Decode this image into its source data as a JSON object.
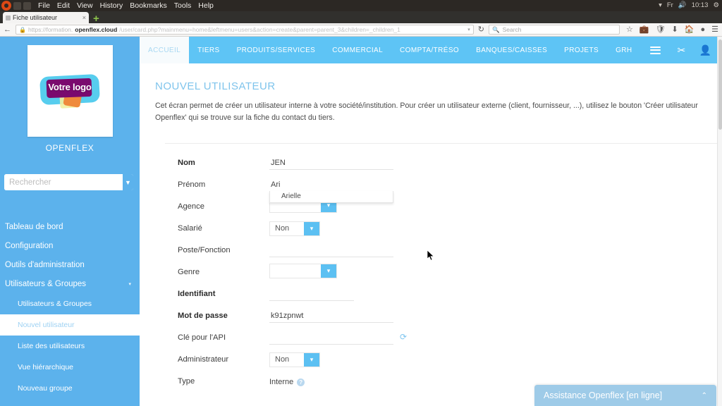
{
  "os": {
    "menus": [
      "File",
      "Edit",
      "View",
      "History",
      "Bookmarks",
      "Tools",
      "Help"
    ],
    "tray": {
      "wifi_icon": "wifi-icon",
      "keyboard_layout": "Fr",
      "volume_icon": "volume-icon",
      "clock": "10:13",
      "settings_icon": "gear-icon"
    }
  },
  "browser": {
    "tab_title": "Fiche utilisateur",
    "tab_close_label": "×",
    "new_tab_label": "+",
    "back_icon": "back-arrow-icon",
    "forward_icon": "forward-arrow-icon",
    "reload_icon": "reload-icon",
    "url": {
      "scheme": "https://formation.",
      "domain": "openflex.cloud",
      "path": "/user/card.php?mainmenu=home&leftmenu=users&action=create&parent=parent_3&children=_children_1",
      "lock_icon": "lock-icon",
      "dropdown_icon": "chevron-down-icon"
    },
    "search_placeholder": "Search",
    "search_icon": "search-icon",
    "toolbar_icons": [
      "star-icon",
      "pocket-icon",
      "shield-icon",
      "download-icon",
      "home-icon",
      "account-icon",
      "hamburger-menu-icon"
    ]
  },
  "sidebar": {
    "logo_text": "Votre logo",
    "app_name": "OPENFLEX",
    "search_placeholder": "Rechercher",
    "search_caret_icon": "chevron-down-icon",
    "items": [
      {
        "label": "Tableau de bord",
        "level": 1,
        "active": false,
        "expand": ""
      },
      {
        "label": "Configuration",
        "level": 1,
        "active": false,
        "expand": ""
      },
      {
        "label": "Outils d'administration",
        "level": 1,
        "active": false,
        "expand": ""
      },
      {
        "label": "Utilisateurs & Groupes",
        "level": 1,
        "active": false,
        "expand": "▾"
      },
      {
        "label": "Utilisateurs & Groupes",
        "level": 2,
        "active": false,
        "expand": ""
      },
      {
        "label": "Nouvel utilisateur",
        "level": 2,
        "active": true,
        "expand": ""
      },
      {
        "label": "Liste des utilisateurs",
        "level": 2,
        "active": false,
        "expand": ""
      },
      {
        "label": "Vue hiérarchique",
        "level": 2,
        "active": false,
        "expand": ""
      },
      {
        "label": "Nouveau groupe",
        "level": 2,
        "active": false,
        "expand": ""
      }
    ]
  },
  "topnav": {
    "tabs": [
      {
        "label": "ACCUEIL",
        "active": true
      },
      {
        "label": "TIERS",
        "active": false
      },
      {
        "label": "PRODUITS/SERVICES",
        "active": false
      },
      {
        "label": "COMMERCIAL",
        "active": false
      },
      {
        "label": "COMPTA/TRÉSO",
        "active": false
      },
      {
        "label": "BANQUES/CAISSES",
        "active": false
      },
      {
        "label": "PROJETS",
        "active": false
      },
      {
        "label": "GRH",
        "active": false
      }
    ],
    "burger_icon": "hamburger-menu-icon",
    "right_icons": [
      {
        "name": "tools-icon",
        "glyph": "⚒"
      },
      {
        "name": "user-icon",
        "glyph": "●"
      },
      {
        "name": "printer-icon",
        "glyph": "⎙"
      },
      {
        "name": "power-icon",
        "glyph": "⏻"
      }
    ]
  },
  "main": {
    "title": "NOUVEL UTILISATEUR",
    "description": "Cet écran permet de créer un utilisateur interne à votre société/institution. Pour créer un utilisateur externe (client, fournisseur, ...), utilisez le bouton 'Créer utilisateur Openflex' qui se trouve sur la fiche du contact du tiers."
  },
  "form": {
    "rows": [
      {
        "label": "Nom",
        "bold": true,
        "type": "input",
        "value": "JEN",
        "placeholder": ""
      },
      {
        "label": "Prénom",
        "bold": false,
        "type": "input",
        "value": "Ari",
        "placeholder": ""
      },
      {
        "label": "Agence",
        "bold": false,
        "type": "select",
        "value": "",
        "placeholder": ""
      },
      {
        "label": "Salarié",
        "bold": false,
        "type": "select",
        "value": "Non",
        "placeholder": ""
      },
      {
        "label": "Poste/Fonction",
        "bold": false,
        "type": "input",
        "value": "",
        "placeholder": ""
      },
      {
        "label": "Genre",
        "bold": false,
        "type": "select",
        "value": "",
        "placeholder": ""
      },
      {
        "label": "Identifiant",
        "bold": true,
        "type": "input",
        "value": "",
        "placeholder": ""
      },
      {
        "label": "Mot de passe",
        "bold": true,
        "type": "input",
        "value": "k91zpnwt",
        "placeholder": ""
      },
      {
        "label": "Clé pour l'API",
        "bold": false,
        "type": "apikey",
        "value": "",
        "placeholder": ""
      },
      {
        "label": "Administrateur",
        "bold": false,
        "type": "select",
        "value": "Non",
        "placeholder": ""
      },
      {
        "label": "Type",
        "bold": false,
        "type": "static",
        "value": "Interne",
        "placeholder": ""
      }
    ],
    "refresh_icon": "refresh-icon",
    "help_icon": "help-icon",
    "help_glyph": "?",
    "select_caret_icon": "chevron-down-icon",
    "autocomplete": {
      "visible": true,
      "suggestions": [
        "Arielle"
      ]
    }
  },
  "chat": {
    "title": "Assistance Openflex [en ligne]",
    "collapse_icon": "chevron-up-icon",
    "collapse_glyph": "⌃"
  },
  "colors": {
    "sidebar_blue": "#5cb2ec",
    "topnav_blue": "#5ec4f5",
    "title_blue": "#7fc4ec",
    "chat_blue": "#9ecbe8",
    "select_caret_blue": "#5cc0f2"
  }
}
